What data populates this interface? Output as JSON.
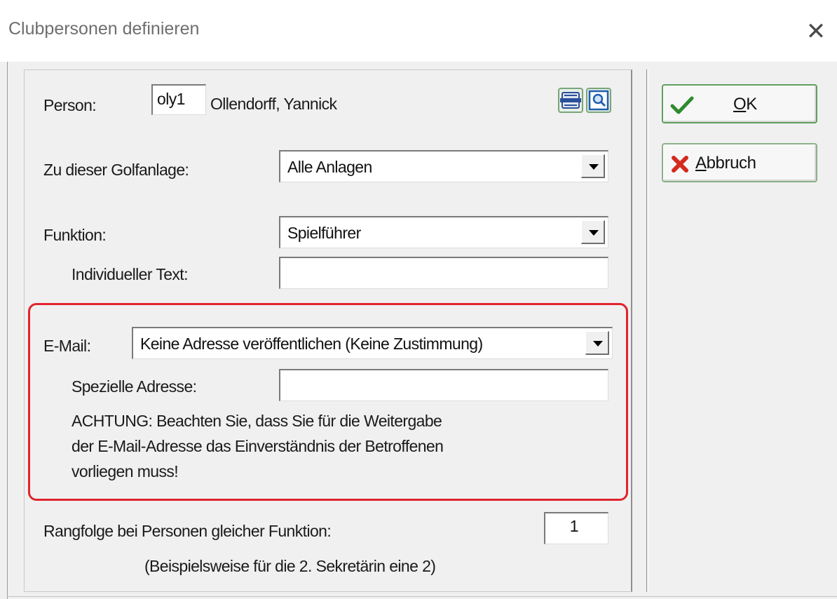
{
  "window": {
    "title": "Clubpersonen definieren",
    "close_glyph": "✕"
  },
  "person": {
    "label": "Person:",
    "code": "oly1",
    "name": "Ollendorff, Yannick",
    "icons": [
      "card-icon",
      "search-icon"
    ]
  },
  "golfanlage": {
    "label": "Zu dieser Golfanlage:",
    "value": "Alle Anlagen"
  },
  "funktion": {
    "label": "Funktion:",
    "value": "Spielführer",
    "individual_label": "Individueller Text:",
    "individual_value": ""
  },
  "email": {
    "label": "E-Mail:",
    "value": "Keine Adresse veröffentlichen (Keine Zustimmung)",
    "special_label": "Spezielle Adresse:",
    "special_value": "",
    "warning_line1": "ACHTUNG: Beachten Sie, dass Sie für die Weitergabe",
    "warning_line2": "der E-Mail-Adresse das Einverständnis der Betroffenen",
    "warning_line3": "vorliegen muss!",
    "highlight_color": "#e0242c"
  },
  "rangfolge": {
    "label": "Rangfolge bei Personen gleicher Funktion:",
    "value": "1",
    "hint": "(Beispielsweise für die 2. Sekretärin eine 2)"
  },
  "buttons": {
    "ok_mnemonic": "O",
    "ok_rest": "K",
    "cancel_mnemonic": "A",
    "cancel_rest": "bbruch",
    "ok_icon": "checkmark-icon",
    "cancel_icon": "red-x-icon"
  }
}
